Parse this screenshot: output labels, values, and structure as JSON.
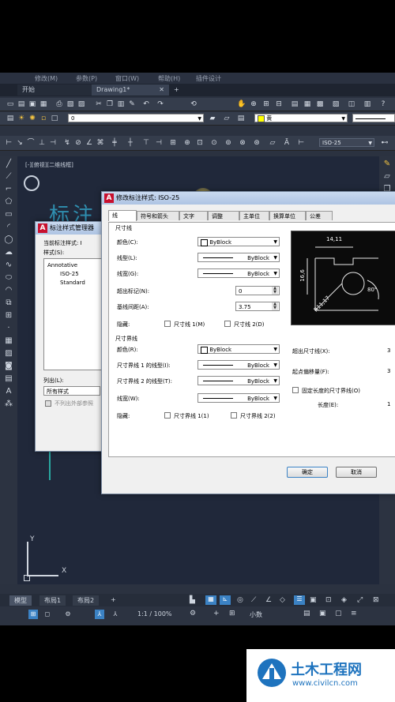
{
  "menu": [
    "修改(M)",
    "参数(P)",
    "窗口(W)",
    "帮助(H)",
    "插件设计"
  ],
  "tabs": [
    {
      "label": "开始"
    },
    {
      "label": "Drawing1*"
    },
    {
      "label": "+"
    }
  ],
  "toolbar": {
    "layer_value": "0",
    "color_value": "黄",
    "dimstyle_value": "ISO-25"
  },
  "viewport_label": "[-][俯视][二维线框]",
  "background_text": "标注",
  "ucs": {
    "x": "X",
    "y": "Y"
  },
  "layout_tabs": [
    "模型",
    "布局1",
    "布局2",
    "+"
  ],
  "status": {
    "scale": "1:1 / 100%",
    "units": "小数"
  },
  "dim_manager": {
    "title": "标注样式管理器",
    "current_style_label": "当前标注样式: I",
    "styles_label": "样式(S):",
    "styles": [
      "Annotative",
      "ISO-25",
      "Standard"
    ],
    "list_label": "列出(L):",
    "list_value": "所有样式",
    "xref_checkbox": "不列出外部参照"
  },
  "modify_dialog": {
    "title": "修改标注样式: ISO-25",
    "tabs": [
      "线",
      "符号和箭头",
      "文字",
      "调整",
      "主单位",
      "换算单位",
      "公差"
    ],
    "dim_lines": {
      "header": "尺寸线",
      "color_label": "颜色(C):",
      "color_value": "ByBlock",
      "linetype_label": "线型(L):",
      "linetype_value": "ByBlock",
      "lineweight_label": "线宽(G):",
      "lineweight_value": "ByBlock",
      "extend_label": "超出标记(N):",
      "extend_value": "0",
      "baseline_label": "基线间距(A):",
      "baseline_value": "3.75",
      "suppress_label": "隐藏:",
      "suppress_1": "尺寸线 1(M)",
      "suppress_2": "尺寸线 2(D)"
    },
    "ext_lines": {
      "header": "尺寸界线",
      "color_label": "颜色(R):",
      "color_value": "ByBlock",
      "lt1_label": "尺寸界线 1 的线型(I):",
      "lt1_value": "ByBlock",
      "lt2_label": "尺寸界线 2 的线型(T):",
      "lt2_value": "ByBlock",
      "lw_label": "线宽(W):",
      "lw_value": "ByBlock",
      "suppress_label": "隐藏:",
      "suppress_1": "尺寸界线 1(1)",
      "suppress_2": "尺寸界线 2(2)",
      "extend_beyond_label": "超出尺寸线(X):",
      "extend_beyond_value": "3",
      "offset_label": "起点偏移量(F):",
      "offset_value": "3",
      "fixed_label": "固定长度的尺寸界线(O)",
      "length_label": "长度(E):",
      "length_value": "1"
    },
    "preview": {
      "d1": "14,11",
      "d2": "16,6",
      "d3": "R11,17",
      "d4": "80°"
    },
    "ok": "确定",
    "cancel": "取消"
  },
  "watermark": {
    "title": "土木工程网",
    "url": "www.civilcn.com"
  },
  "colors": {
    "accent": "#3b82c4",
    "bg": "#2b3240",
    "dialog": "#f0f0f0"
  }
}
